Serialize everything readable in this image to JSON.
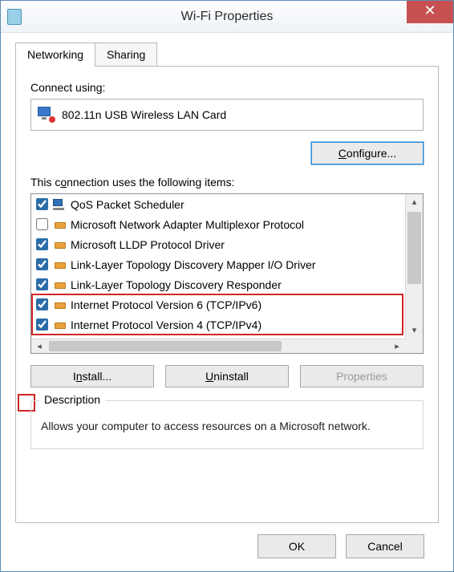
{
  "window": {
    "title": "Wi-Fi Properties"
  },
  "tabs": {
    "networking": "Networking",
    "sharing": "Sharing"
  },
  "connect_using_label": "Connect using:",
  "adapter": {
    "name": "802.11n USB Wireless LAN Card"
  },
  "configure_button": "Configure...",
  "configure_button_prefix": "C",
  "configure_button_suffix": "onfigure...",
  "items_label_prefix": "This c",
  "items_label_u": "o",
  "items_label_suffix": "nnection uses the following items:",
  "items": [
    {
      "checked": true,
      "icon": "qos",
      "label": "QoS Packet Scheduler"
    },
    {
      "checked": false,
      "icon": "driver",
      "label": "Microsoft Network Adapter Multiplexor Protocol"
    },
    {
      "checked": true,
      "icon": "driver",
      "label": "Microsoft LLDP Protocol Driver"
    },
    {
      "checked": true,
      "icon": "driver",
      "label": "Link-Layer Topology Discovery Mapper I/O Driver"
    },
    {
      "checked": true,
      "icon": "driver",
      "label": "Link-Layer Topology Discovery Responder"
    },
    {
      "checked": true,
      "icon": "driver",
      "label": "Internet Protocol Version 6 (TCP/IPv6)"
    },
    {
      "checked": true,
      "icon": "driver",
      "label": "Internet Protocol Version 4 (TCP/IPv4)"
    }
  ],
  "buttons": {
    "install_prefix": "I",
    "install_u": "n",
    "install_suffix": "stall...",
    "uninstall_prefix": "",
    "uninstall_u": "U",
    "uninstall_suffix": "ninstall",
    "properties_prefix": "P",
    "properties_u": "r",
    "properties_suffix": "operties"
  },
  "description": {
    "legend": "Description",
    "text": "Allows your computer to access resources on a Microsoft network."
  },
  "footer": {
    "ok": "OK",
    "cancel": "Cancel"
  }
}
